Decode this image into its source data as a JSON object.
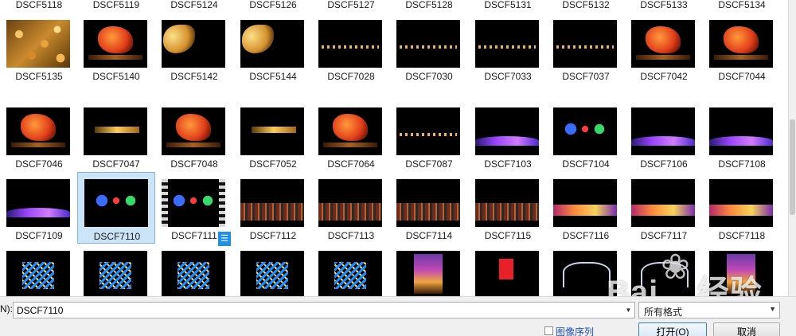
{
  "rows": [
    {
      "items": [
        {
          "label": "DSCF5118",
          "style": "bokeh"
        },
        {
          "label": "DSCF5119",
          "style": "bokeh"
        },
        {
          "label": "DSCF5124",
          "style": "bokeh"
        },
        {
          "label": "DSCF5126",
          "style": "bokeh"
        },
        {
          "label": "DSCF5127",
          "style": "bokeh"
        },
        {
          "label": "DSCF5128",
          "style": "bokeh"
        },
        {
          "label": "DSCF5131",
          "style": "bokeh"
        },
        {
          "label": "DSCF5132",
          "style": "bokeh"
        },
        {
          "label": "DSCF5133",
          "style": "bokeh"
        },
        {
          "label": "DSCF5134",
          "style": "bokeh"
        }
      ]
    },
    {
      "items": [
        {
          "label": "DSCF5135",
          "style": "bokeh"
        },
        {
          "label": "DSCF5140",
          "style": "dragon"
        },
        {
          "label": "DSCF5142",
          "style": "side-dragon"
        },
        {
          "label": "DSCF5144",
          "style": "side-dragon"
        },
        {
          "label": "DSCF7028",
          "style": "lights-row"
        },
        {
          "label": "DSCF7030",
          "style": "lights-row"
        },
        {
          "label": "DSCF7033",
          "style": "lights-row"
        },
        {
          "label": "DSCF7037",
          "style": "lights-row"
        },
        {
          "label": "DSCF7042",
          "style": "dragon"
        },
        {
          "label": "DSCF7044",
          "style": "dragon"
        }
      ]
    },
    {
      "items": [
        {
          "label": "DSCF7046",
          "style": "dragon"
        },
        {
          "label": "DSCF7047",
          "style": "bar-gold"
        },
        {
          "label": "DSCF7048",
          "style": "dragon"
        },
        {
          "label": "DSCF7052",
          "style": "bar-gold"
        },
        {
          "label": "DSCF7064",
          "style": "dragon"
        },
        {
          "label": "DSCF7087",
          "style": "lights-row"
        },
        {
          "label": "DSCF7103",
          "style": "purple-wave"
        },
        {
          "label": "DSCF7104",
          "style": "colorful"
        },
        {
          "label": "DSCF7106",
          "style": "purple-wave"
        },
        {
          "label": "DSCF7108",
          "style": "purple-wave"
        }
      ]
    },
    {
      "items": [
        {
          "label": "DSCF7109",
          "style": "purple-wave"
        },
        {
          "label": "DSCF7110",
          "style": "colorful",
          "selected": true
        },
        {
          "label": "DSCF7111",
          "style": "video"
        },
        {
          "label": "DSCF7112",
          "style": "crowd"
        },
        {
          "label": "DSCF7113",
          "style": "crowd"
        },
        {
          "label": "DSCF7114",
          "style": "crowd"
        },
        {
          "label": "DSCF7115",
          "style": "crowd"
        },
        {
          "label": "DSCF7116",
          "style": "pink-stripe"
        },
        {
          "label": "DSCF7117",
          "style": "pink-stripe"
        },
        {
          "label": "DSCF7118",
          "style": "pink-stripe"
        }
      ]
    },
    {
      "items": [
        {
          "label": "",
          "style": "chevrons"
        },
        {
          "label": "",
          "style": "chevrons"
        },
        {
          "label": "",
          "style": "chevrons"
        },
        {
          "label": "",
          "style": "chevrons"
        },
        {
          "label": "",
          "style": "chevrons"
        },
        {
          "label": "",
          "style": "city"
        },
        {
          "label": "",
          "style": "red-sign"
        },
        {
          "label": "",
          "style": "dark-arch"
        },
        {
          "label": "",
          "style": "dark-arch"
        },
        {
          "label": "",
          "style": "city"
        }
      ]
    }
  ],
  "bottom": {
    "filename_label": "N):",
    "filename_value": "DSCF7110",
    "format_value": "所有格式",
    "sequence_label": "图像序列",
    "open_label": "打开(O)",
    "cancel_label": "取消"
  },
  "watermark": {
    "brand": "Bai",
    "brand_suffix": "经验",
    "url": "jingyan.baidu.com"
  },
  "colors": {
    "selection_fill": "#cce4f7",
    "selection_border": "#7eb4ea",
    "video_badge": "#1e90e8"
  }
}
